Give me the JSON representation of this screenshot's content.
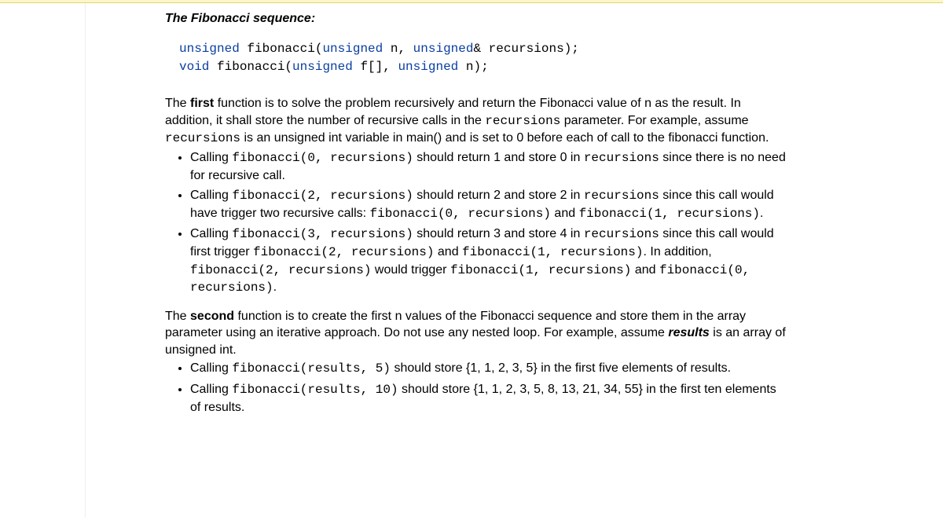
{
  "heading": "The Fibonacci sequence:",
  "code": {
    "kw_unsigned": "unsigned",
    "kw_void": "void",
    "line1_mid": " fibonacci(",
    "line1_n": " n, ",
    "line1_end": "& recursions);",
    "line2_mid": " fibonacci(",
    "line2_f": " f[], ",
    "line2_end": " n);"
  },
  "p1_a": "The ",
  "p1_first": "first",
  "p1_b": " function is to solve the problem recursively and return the Fibonacci value of n as the result. In addition, it shall store the number of recursive calls in the ",
  "p1_code1": "recursions",
  "p1_c": " parameter. For example, assume ",
  "p1_code2": "recursions",
  "p1_d": " is an unsigned int variable in main() and is set to 0 before each of call to the fibonacci function.",
  "b1_a": "Calling ",
  "b1_code1": "fibonacci(0, recursions)",
  "b1_b": " should return 1 and store 0 in ",
  "b1_code2": "recursions",
  "b1_c": " since there is no need for recursive call.",
  "b2_a": "Calling ",
  "b2_code1": "fibonacci(2, recursions)",
  "b2_b": " should return 2 and store 2 in ",
  "b2_code2": "recursions",
  "b2_c": " since this call would have trigger two recursive calls: ",
  "b2_code3": "fibonacci(0, recursions)",
  "b2_d": " and ",
  "b2_code4": "fibonacci(1, recursions)",
  "b2_e": ".",
  "b3_a": "Calling ",
  "b3_code1": "fibonacci(3, recursions)",
  "b3_b": " should return 3 and store 4 in ",
  "b3_code2": "recursions",
  "b3_c": " since this call would first trigger ",
  "b3_code3": "fibonacci(2, recursions)",
  "b3_d": " and ",
  "b3_code4": "fibonacci(1, recursions)",
  "b3_e": ". In addition, ",
  "b3_code5": "fibonacci(2, recursions)",
  "b3_f": " would trigger ",
  "b3_code6": "fibonacci(1, recursions)",
  "b3_g": " and ",
  "b3_code7": "fibonacci(0, recursions)",
  "b3_h": ".",
  "p2_a": "The ",
  "p2_second": "second",
  "p2_b": " function is to create the first n values of the Fibonacci sequence and store them in the array parameter using an iterative approach. Do not use any nested loop. For example, assume ",
  "p2_results": "results",
  "p2_c": " is an array of unsigned int.",
  "b4_a": "Calling ",
  "b4_code1": "fibonacci(results, 5)",
  "b4_b": " should store {1, 1, 2, 3, 5} in the first five elements of results.",
  "b5_a": "Calling ",
  "b5_code1": "fibonacci(results, 10)",
  "b5_b": " should store {1, 1, 2, 3, 5, 8, 13, 21, 34, 55} in the first ten elements of results."
}
